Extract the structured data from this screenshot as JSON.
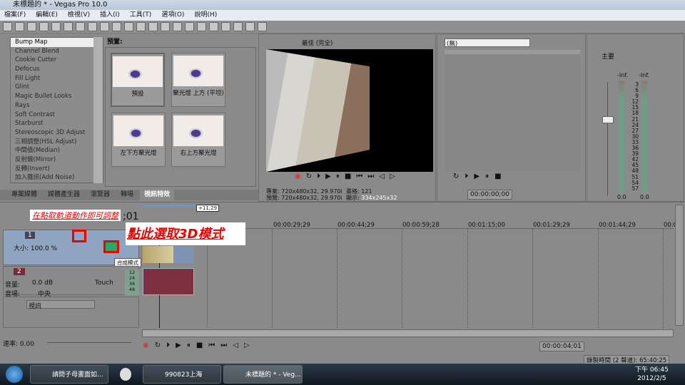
{
  "window": {
    "title": "未標題的 * - Vegas Pro 10.0"
  },
  "menu": [
    "檔案(F)",
    "編輯(E)",
    "檢視(V)",
    "插入(I)",
    "工具(T)",
    "選項(O)",
    "說明(H)"
  ],
  "fx_list": {
    "items": [
      "Bump Map",
      "Channel Blend",
      "Cookie Cutter",
      "Defocus",
      "Fill Light",
      "Glint",
      "Magic Bullet Looks",
      "Rays",
      "Soft Contrast",
      "Starburst",
      "Stereoscopic 3D Adjust",
      "三相調整(HSL Adjust)",
      "中間值(Median)",
      "反射鏡(Mirror)",
      "反轉(Invert)",
      "加入雜訊(Add Noise)"
    ],
    "selected": "Bump Map"
  },
  "presets": {
    "label": "預置:",
    "items": [
      "預設",
      "聚光燈 上方 (平坦)",
      "左下方聚光燈",
      "右上方聚光燈"
    ]
  },
  "tabs": [
    {
      "label": "專案媒體"
    },
    {
      "label": "媒體產生器"
    },
    {
      "label": "瀏覽器"
    },
    {
      "label": "轉場"
    },
    {
      "label": "視訊特效",
      "active": true
    }
  ],
  "preview": {
    "quality": "最佳 (完全)",
    "project": "專案: 720x480x32, 29.970i",
    "preview": "預覽: 720x480x32, 29.970i",
    "frame": "畫格: 121",
    "display_label": "顯示:",
    "display": "334x245x32"
  },
  "trimmer": {
    "dropdown": "(無)",
    "timecode": "00:00:00;00"
  },
  "mixer": {
    "label": "主要",
    "left_peak": "-Inf.",
    "right_peak": "-Inf.",
    "scale": [
      "3",
      "6",
      "9",
      "12",
      "15",
      "18",
      "21",
      "24",
      "27",
      "30",
      "33",
      "36",
      "39",
      "42",
      "45",
      "48",
      "51",
      "54",
      "57"
    ],
    "left_value": "0.0",
    "right_value": "0.0"
  },
  "timeline": {
    "cursor_time": ";01",
    "offset": "+11;29",
    "ruler": [
      "00:00:29;29",
      "00:00:44;29",
      "00:00:59;28",
      "00:01:15;00",
      "00:01:29;29",
      "00:01:44;29",
      "00:0"
    ],
    "tracks": [
      {
        "number": "1",
        "size_label": "大小:",
        "size": "100.0 %",
        "tooltip": "合成模式"
      },
      {
        "number": "2",
        "volume_label": "音量:",
        "volume": "0.0 dB",
        "automation": "Touch",
        "pan_label": "音場:",
        "pan": "中央",
        "meter": [
          "12",
          "24",
          "36",
          "48"
        ]
      },
      {
        "name": "視訊"
      }
    ],
    "rate": "速率: 0.00",
    "timecode": "00:00:04;01"
  },
  "annotations": {
    "hint1": "在點取軌道動作即可調整",
    "hint2": "點此選取3D模式"
  },
  "status": {
    "record_time": "錄製時間 (2 聲道): 65:40:25"
  },
  "taskbar": {
    "items": [
      "請問子母畫面如...",
      "990823上海",
      "未標題的 * - Veg..."
    ],
    "time": "下午 06:45",
    "date": "2012/2/5"
  }
}
